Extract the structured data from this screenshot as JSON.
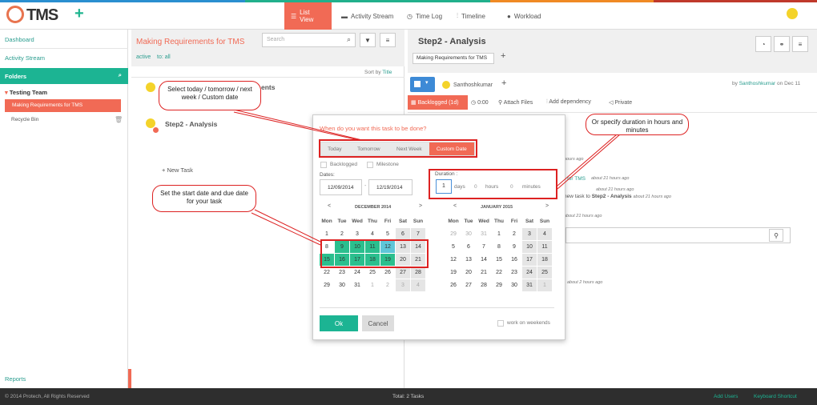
{
  "header": {
    "logo_text": "TMS",
    "add_label": "+",
    "nav": [
      {
        "label": "List View",
        "icon": "list-icon"
      },
      {
        "label": "Activity Stream",
        "icon": "comment-icon"
      },
      {
        "label": "Time Log",
        "icon": "clock-icon"
      },
      {
        "label": "Timeline",
        "icon": "timeline-icon"
      },
      {
        "label": "Workload",
        "icon": "user-icon"
      }
    ]
  },
  "sidebar": {
    "dashboard": "Dashboard",
    "activity": "Activity Stream",
    "folders": "Folders",
    "team": "Testing Team",
    "project": "Making Requirements for TMS",
    "recycle": "Recycle Bin",
    "reports": "Reports"
  },
  "middle": {
    "title": "Making Requirements for TMS",
    "search_placeholder": "Search",
    "filter_active": "active",
    "filter_all": "to: all",
    "sort_prefix": "Sort by",
    "sort_field": "Title",
    "task1_suffix": "ents",
    "task2": "Step2 - Analysis",
    "new_task": "New Task"
  },
  "right": {
    "title": "Step2 - Analysis",
    "tag": "Making Requirements for TMS",
    "assignee": "Santhoshkumar",
    "byline_prefix": "by",
    "byline_user": "Santhoshkumar",
    "byline_suffix": "on Dec 11",
    "status_btn": "Backlogged (1d)",
    "time": "0:00",
    "attach": "Attach Files",
    "dependency": "Add dependency",
    "private": "Private",
    "act1": "hours ago",
    "act2_link": "for TMS",
    "act2_time": "about 21 hours ago",
    "act3_time": "about 21 hours ago",
    "act4_text": "new task to",
    "act4_bold": "Step2 - Analysis",
    "act4_time": "about 21 hours ago",
    "act5_time": "about 21 hours ago",
    "act6_time": "about 2 hours ago"
  },
  "popup": {
    "question": "When do you want this task to be done?",
    "tabs": [
      "Today",
      "Tomorrow",
      "Next Week",
      "Custom Date"
    ],
    "backlogged": "Backlogged",
    "milestone": "Milestone",
    "dates_label": "Dates:",
    "start_date": "12/09/2014",
    "due_date": "12/19/2014",
    "duration_label": "Duration :",
    "days_value": "1",
    "days": "days",
    "hours_value": "0",
    "hours": "hours",
    "minutes_value": "0",
    "minutes": "minutes",
    "ok": "Ok",
    "cancel": "Cancel",
    "weekends": "work on weekends",
    "prev": "<",
    "next": ">"
  },
  "calendar_dec": {
    "title": "DECEMBER 2014",
    "weekdays": [
      "Mon",
      "Tue",
      "Wed",
      "Thu",
      "Fri",
      "Sat",
      "Sun"
    ],
    "rows": [
      [
        "1",
        "2",
        "3",
        "4",
        "5",
        "6",
        "7"
      ],
      [
        "8",
        "9",
        "10",
        "11",
        "12",
        "13",
        "14"
      ],
      [
        "15",
        "16",
        "17",
        "18",
        "19",
        "20",
        "21"
      ],
      [
        "22",
        "23",
        "24",
        "25",
        "26",
        "27",
        "28"
      ],
      [
        "29",
        "30",
        "31",
        "1",
        "2",
        "3",
        "4"
      ]
    ]
  },
  "calendar_jan": {
    "title": "JANUARY 2015",
    "weekdays": [
      "Mon",
      "Tue",
      "Wed",
      "Thu",
      "Fri",
      "Sat",
      "Sun"
    ],
    "rows": [
      [
        "29",
        "30",
        "31",
        "1",
        "2",
        "3",
        "4"
      ],
      [
        "5",
        "6",
        "7",
        "8",
        "9",
        "10",
        "11"
      ],
      [
        "12",
        "13",
        "14",
        "15",
        "16",
        "17",
        "18"
      ],
      [
        "19",
        "20",
        "21",
        "22",
        "23",
        "24",
        "25"
      ],
      [
        "26",
        "27",
        "28",
        "29",
        "30",
        "31",
        "1"
      ]
    ]
  },
  "callouts": {
    "c1": "Select today / tomorrow / next week / Custom date",
    "c2": "Or specify duration in hours and minutes",
    "c3": "Set the start date and due date for your task"
  },
  "footer": {
    "copyright": "© 2014 Protech, All Rights Reserved",
    "total": "Total: 2 Tasks",
    "add_users": "Add Users",
    "shortcut": "Keyboard Shortcut"
  },
  "colors": {
    "accent": "#f16a55",
    "teal": "#1cb493"
  }
}
